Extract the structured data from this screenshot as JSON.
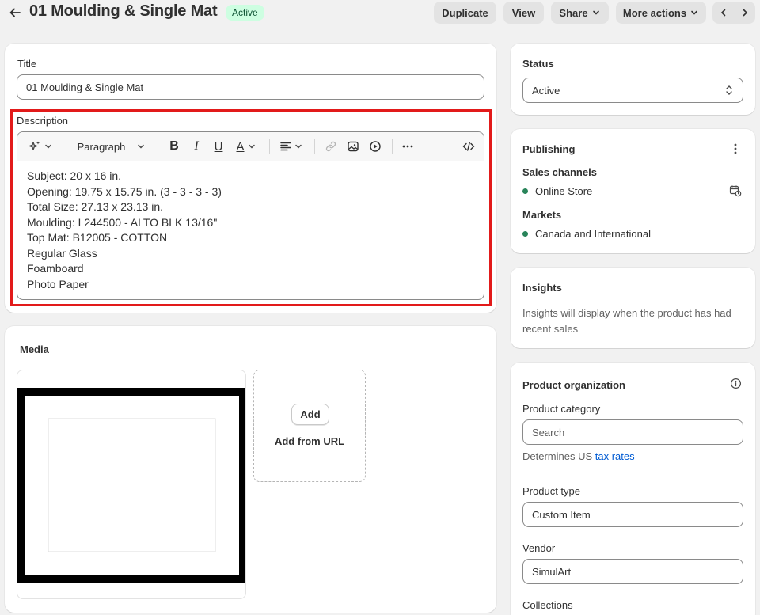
{
  "header": {
    "title": "01 Moulding & Single Mat",
    "status_badge": "Active",
    "buttons": {
      "duplicate": "Duplicate",
      "view": "View",
      "share": "Share",
      "more_actions": "More actions"
    }
  },
  "title_card": {
    "label": "Title",
    "value": "01 Moulding & Single Mat"
  },
  "description": {
    "label": "Description",
    "paragraph_select": "Paragraph",
    "lines": [
      "Subject: 20 x 16 in.",
      "Opening: 19.75 x 15.75 in. (3 - 3 - 3 - 3)",
      "Total Size: 27.13 x 23.13 in.",
      "Moulding: L244500 - ALTO BLK 13/16\"",
      "Top Mat: B12005 - COTTON",
      "Regular Glass",
      "Foamboard",
      "Photo Paper"
    ]
  },
  "media": {
    "title": "Media",
    "add_button": "Add",
    "add_from_url": "Add from URL"
  },
  "status_card": {
    "title": "Status",
    "value": "Active"
  },
  "publishing": {
    "title": "Publishing",
    "sales_channels_label": "Sales channels",
    "sales_channel": "Online Store",
    "markets_label": "Markets",
    "market": "Canada and International",
    "status_color": "#29845a"
  },
  "insights": {
    "title": "Insights",
    "text": "Insights will display when the product has had recent sales"
  },
  "organization": {
    "title": "Product organization",
    "category_label": "Product category",
    "category_placeholder": "Search",
    "category_hint_prefix": "Determines US ",
    "category_hint_link": "tax rates",
    "type_label": "Product type",
    "type_value": "Custom Item",
    "vendor_label": "Vendor",
    "vendor_value": "SimulArt",
    "collections_label": "Collections"
  },
  "colors": {
    "highlight": "#e21a1a",
    "active_badge_bg": "#cdfee1",
    "active_badge_text": "#0c5132",
    "link": "#005bd3"
  }
}
